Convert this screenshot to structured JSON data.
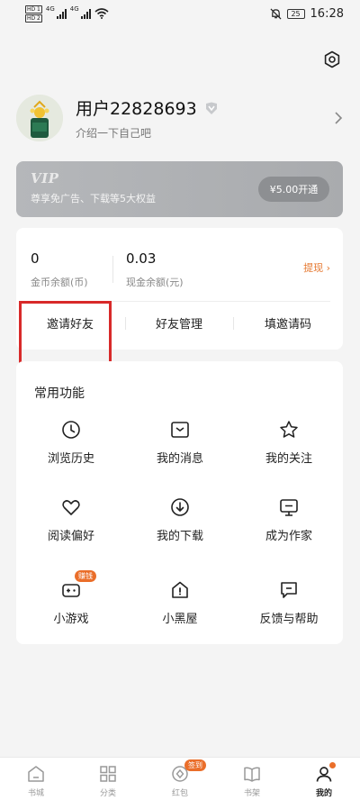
{
  "status_bar": {
    "sim1": "HD 1",
    "sim2": "HD 2",
    "net1": "4G",
    "net2": "4G",
    "battery": "25",
    "time": "16:28"
  },
  "profile": {
    "username": "用户22828693",
    "bio": "介绍一下自己吧"
  },
  "vip": {
    "title": "VIP",
    "description": "尊享免广告、下载等5大权益",
    "button_label": "¥5.00开通"
  },
  "wallet": {
    "coins_value": "0",
    "coins_label": "金币余额(币)",
    "cash_value": "0.03",
    "cash_label": "现金余额(元)",
    "withdraw_label": "提现 ›",
    "actions": [
      "邀请好友",
      "好友管理",
      "填邀请码"
    ]
  },
  "functions": {
    "title": "常用功能",
    "earn_badge": "赚钱",
    "items": [
      {
        "label": "浏览历史",
        "icon": "clock-icon"
      },
      {
        "label": "我的消息",
        "icon": "message-icon"
      },
      {
        "label": "我的关注",
        "icon": "star-icon"
      },
      {
        "label": "阅读偏好",
        "icon": "heart-icon"
      },
      {
        "label": "我的下载",
        "icon": "download-icon"
      },
      {
        "label": "成为作家",
        "icon": "writer-icon"
      },
      {
        "label": "小游戏",
        "icon": "gamepad-icon"
      },
      {
        "label": "小黑屋",
        "icon": "house-icon"
      },
      {
        "label": "反馈与帮助",
        "icon": "feedback-icon"
      }
    ]
  },
  "tabbar": {
    "tabs": [
      {
        "label": "书城",
        "icon": "bookstore-icon"
      },
      {
        "label": "分类",
        "icon": "category-icon"
      },
      {
        "label": "红包",
        "icon": "redpacket-icon"
      },
      {
        "label": "书架",
        "icon": "bookshelf-icon"
      },
      {
        "label": "我的",
        "icon": "profile-icon"
      }
    ],
    "signin_badge": "签到"
  },
  "colors": {
    "accent": "#ea6e2a",
    "highlight_box": "#d82a2a",
    "vip_card": "#b0b2b5"
  }
}
